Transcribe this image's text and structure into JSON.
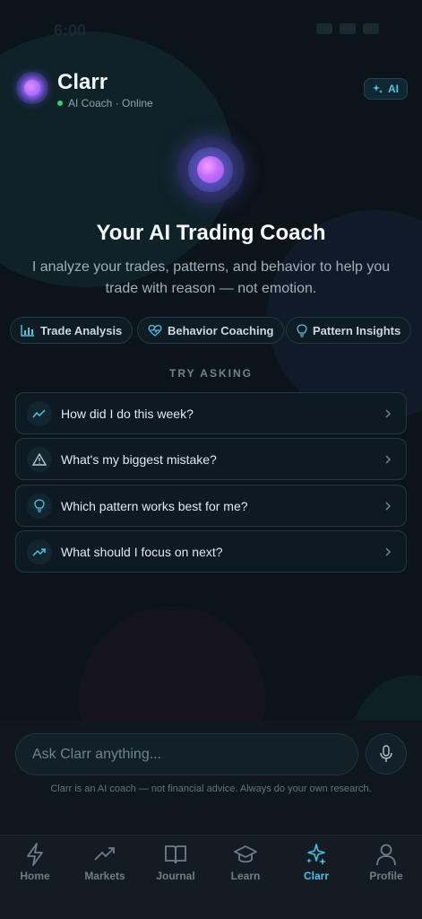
{
  "status_bar": {
    "time": "6:00"
  },
  "header": {
    "title": "Clarr",
    "status": "AI Coach · Online",
    "badge": "AI"
  },
  "hero": {
    "title": "Your AI Trading Coach",
    "subtitle": "I analyze your trades, patterns, and behavior to help you trade with reason — not emotion."
  },
  "chips": [
    {
      "label": "Trade Analysis",
      "icon": "bar-chart-icon"
    },
    {
      "label": "Behavior Coaching",
      "icon": "heart-pulse-icon"
    },
    {
      "label": "Pattern Insights",
      "icon": "lightbulb-icon"
    }
  ],
  "try_asking": "TRY ASKING",
  "suggestions": [
    {
      "text": "How did I do this week?",
      "icon": "trend-line-icon"
    },
    {
      "text": "What's my biggest mistake?",
      "icon": "warning-icon"
    },
    {
      "text": "Which pattern works best for me?",
      "icon": "lightbulb-icon"
    },
    {
      "text": "What should I focus on next?",
      "icon": "trending-up-icon"
    }
  ],
  "input": {
    "placeholder": "Ask Clarr anything...",
    "value": ""
  },
  "disclaimer": "Clarr is an AI coach — not financial advice. Always do your own research.",
  "tabs": [
    {
      "label": "Home",
      "icon": "bolt-icon"
    },
    {
      "label": "Markets",
      "icon": "trending-up-icon"
    },
    {
      "label": "Journal",
      "icon": "book-icon"
    },
    {
      "label": "Learn",
      "icon": "graduation-cap-icon"
    },
    {
      "label": "Clarr",
      "icon": "sparkles-icon",
      "active": true
    },
    {
      "label": "Profile",
      "icon": "user-icon"
    }
  ],
  "colors": {
    "background": "#0b1419",
    "accent": "#3fc3e8",
    "online": "#34d27a",
    "orb": "#c56bf7"
  }
}
